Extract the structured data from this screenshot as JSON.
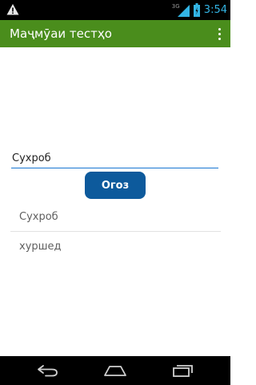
{
  "status_bar": {
    "network_type": "3G",
    "clock": "3:54",
    "icons": [
      "warning-icon",
      "signal-icon",
      "battery-icon"
    ],
    "accent_color": "#33b5e5"
  },
  "action_bar": {
    "title": "Маҷмӯаи тестҳо",
    "background_color": "#4a8d1c",
    "menu_icon": "overflow-menu-icon"
  },
  "form": {
    "input_value": "Сухроб",
    "button_label": "Огоз",
    "button_color": "#0d5a9c"
  },
  "list": {
    "items": [
      "Сухроб",
      "хуршед"
    ]
  },
  "nav_bar": {
    "icons": [
      "back-icon",
      "home-icon",
      "recents-icon"
    ]
  }
}
